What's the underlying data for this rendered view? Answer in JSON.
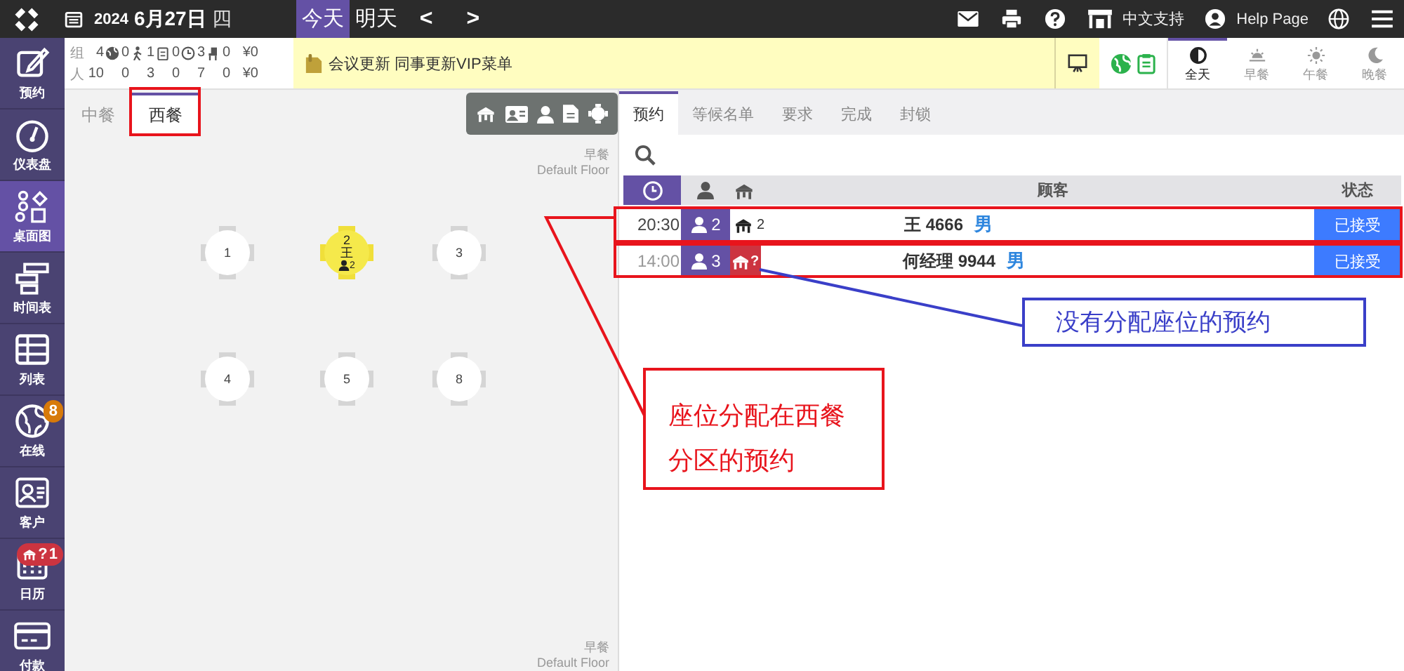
{
  "topbar": {
    "date_year": "2024",
    "date": "6月27日",
    "weekday": "四",
    "day_tabs": [
      {
        "label": "今天",
        "selected": true
      },
      {
        "label": "明天",
        "selected": false
      }
    ],
    "prev": "<",
    "next": ">",
    "support": "中文支持",
    "help": "Help Page"
  },
  "sidebar": {
    "items": [
      {
        "kind": "booking",
        "label": "预约",
        "selected": false
      },
      {
        "kind": "dashboard",
        "label": "仪表盘",
        "selected": false
      },
      {
        "kind": "floorplan",
        "label": "桌面图",
        "selected": true
      },
      {
        "kind": "timeline",
        "label": "时间表",
        "selected": false
      },
      {
        "kind": "list",
        "label": "列表",
        "selected": false
      },
      {
        "kind": "online",
        "label": "在线",
        "selected": false,
        "badge": "8"
      },
      {
        "kind": "guests",
        "label": "客户",
        "selected": false
      },
      {
        "kind": "calendar",
        "label": "日历",
        "selected": false,
        "badge": "1",
        "badge_mark": "?"
      },
      {
        "kind": "payment",
        "label": "付款",
        "selected": false
      }
    ]
  },
  "stats": {
    "group_label": "组",
    "people_label": "人",
    "columns": [
      {
        "kind": "total",
        "group": "4",
        "people": "10"
      },
      {
        "kind": "online",
        "group": "0",
        "people": "0"
      },
      {
        "kind": "walkin",
        "group": "1",
        "people": "3"
      },
      {
        "kind": "booked",
        "group": "0",
        "people": "0"
      },
      {
        "kind": "waiting",
        "group": "3",
        "people": "7"
      },
      {
        "kind": "seated",
        "group": "0",
        "people": "0"
      },
      {
        "kind": "revenue",
        "group": "¥0",
        "people": "¥0"
      }
    ]
  },
  "notice": "会议更新 同事更新VIP菜单",
  "meal_tabs": [
    {
      "kind": "allday",
      "label": "全天",
      "selected": true
    },
    {
      "kind": "breakfast",
      "label": "早餐",
      "selected": false
    },
    {
      "kind": "lunch",
      "label": "午餐",
      "selected": false
    },
    {
      "kind": "dinner",
      "label": "晚餐",
      "selected": false
    }
  ],
  "floor": {
    "tabs": [
      {
        "label": "中餐",
        "selected": false
      },
      {
        "label": "西餐",
        "selected": true
      }
    ],
    "meal": "早餐",
    "floor_name": "Default Floor",
    "footer_meal": "早餐",
    "footer_floor": "Default Floor",
    "tables": [
      {
        "number": "1",
        "occupied": false
      },
      {
        "number": "2",
        "occupied": true,
        "guest": "王",
        "party": "2"
      },
      {
        "number": "3",
        "occupied": false
      },
      {
        "number": "4",
        "occupied": false
      },
      {
        "number": "5",
        "occupied": false
      },
      {
        "number": "8",
        "occupied": false
      }
    ]
  },
  "reservations": {
    "tabs": [
      {
        "label": "预约",
        "selected": true
      },
      {
        "label": "等候名单",
        "selected": false
      },
      {
        "label": "要求",
        "selected": false
      },
      {
        "label": "完成",
        "selected": false
      },
      {
        "label": "封锁",
        "selected": false
      }
    ],
    "columns": {
      "customer": "顾客",
      "status": "状态"
    },
    "rows": [
      {
        "time": "20:30",
        "past": false,
        "party": "2",
        "assigned": true,
        "table": "2",
        "name": "王 4666",
        "gender": "男",
        "status": "已接受"
      },
      {
        "time": "14:00",
        "past": true,
        "party": "3",
        "assigned": false,
        "table": "?",
        "name": "何经理 9944",
        "gender": "男",
        "status": "已接受"
      }
    ]
  },
  "annotations": [
    {
      "color": "#e8141c",
      "text": "座位分配在西餐分区的预约"
    },
    {
      "color": "#3a3fc8",
      "text": "没有分配座位的预约"
    }
  ]
}
